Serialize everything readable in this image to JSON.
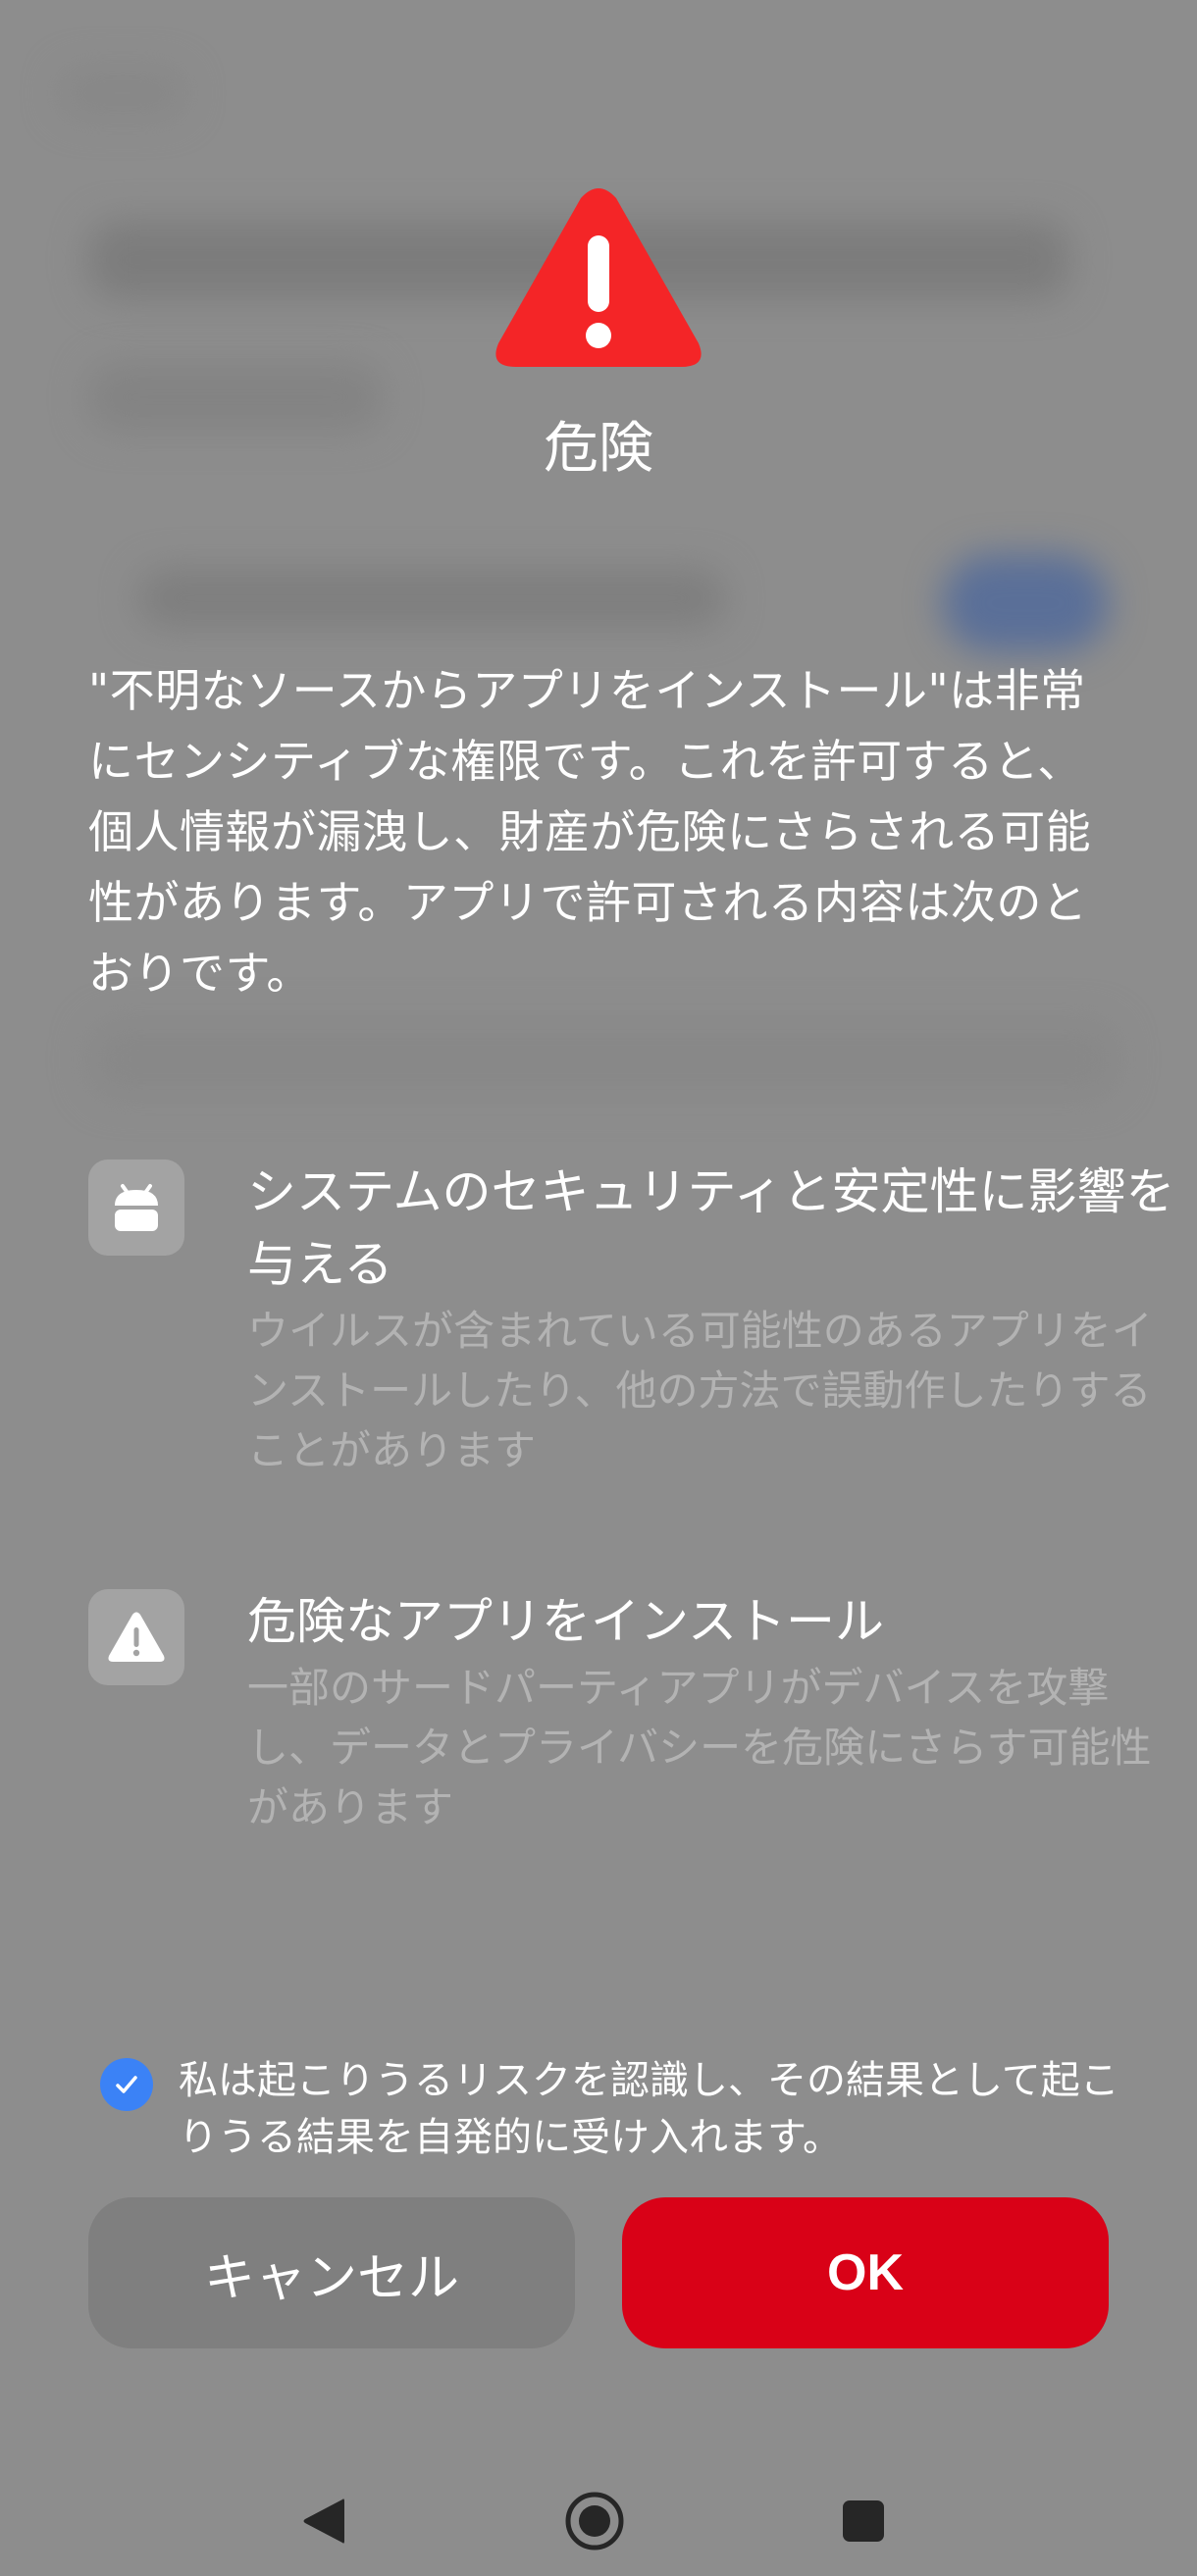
{
  "dialog": {
    "title": "危険",
    "description": "\"不明なソースからアプリをインストール\"は非常にセンシティブな権限です。これを許可すると、個人情報が漏洩し、財産が危険にさらされる可能性があります。アプリで許可される内容は次のとおりです。",
    "permissions": [
      {
        "icon": "android-icon",
        "title": "システムのセキュリティと安定性に影響を与える",
        "subtitle": "ウイルスが含まれている可能性のあるアプリをインストールしたり、他の方法で誤動作したりすることがあります"
      },
      {
        "icon": "warning-icon",
        "title": "危険なアプリをインストール",
        "subtitle": "一部のサードパーティアプリがデバイスを攻撃し、データとプライバシーを危険にさらす可能性があります"
      }
    ],
    "consent": {
      "checked": true,
      "text": "私は起こりうるリスクを認識し、その結果として起こりうる結果を自発的に受け入れます。"
    },
    "buttons": {
      "cancel": "キャンセル",
      "ok": "OK"
    }
  },
  "colors": {
    "warning_red": "#f42527",
    "ok_button": "#d90117",
    "checkbox_blue": "#3b82f6",
    "backdrop": "#8d8d8d"
  },
  "nav_bar": {
    "icons": [
      "back-triangle-icon",
      "home-circle-icon",
      "recents-square-icon"
    ]
  }
}
